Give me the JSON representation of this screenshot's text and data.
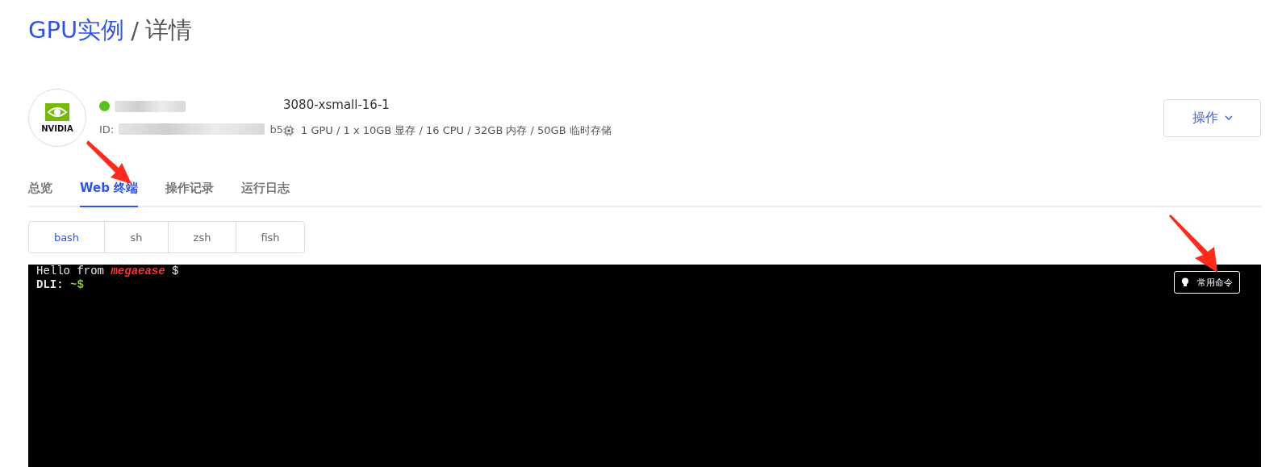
{
  "breadcrumb": {
    "parent": "GPU实例",
    "separator": "/",
    "current": "详情"
  },
  "instance": {
    "running": true,
    "id_label": "ID:",
    "id_tail": "b5",
    "spec_name": "3080-xsmall-16-1",
    "spec_detail": "1 GPU / 1 x 10GB 显存 / 16 CPU / 32GB 内存 / 50GB 临时存储",
    "logo_text": "NVIDIA"
  },
  "actions_button": {
    "label": "操作"
  },
  "tabs": [
    {
      "label": "总览",
      "selected": false
    },
    {
      "label": "Web 终端",
      "selected": true
    },
    {
      "label": "操作记录",
      "selected": false
    },
    {
      "label": "运行日志",
      "selected": false
    }
  ],
  "shells": [
    {
      "label": "bash",
      "selected": true
    },
    {
      "label": "sh",
      "selected": false
    },
    {
      "label": "zsh",
      "selected": false
    },
    {
      "label": "fish",
      "selected": false
    }
  ],
  "terminal": {
    "lines": [
      {
        "parts": [
          {
            "text": "Hello from ",
            "kind": "plain"
          },
          {
            "text": "megaease",
            "kind": "accent"
          },
          {
            "text": " $",
            "kind": "plain"
          }
        ]
      },
      {
        "parts": [
          {
            "text": "DLI:",
            "kind": "bold"
          },
          {
            "text": " ~$",
            "kind": "prompt"
          }
        ]
      }
    ],
    "commands_button": {
      "label": "常用命令"
    }
  }
}
